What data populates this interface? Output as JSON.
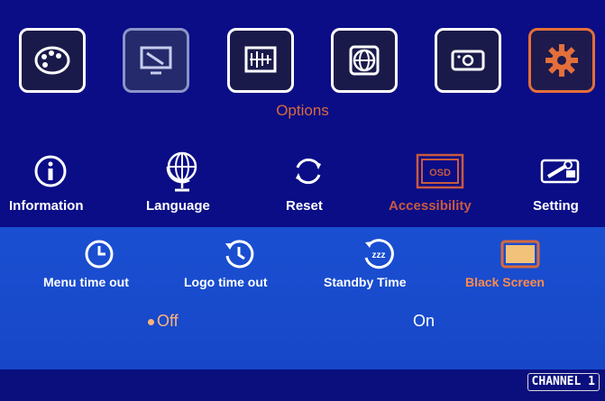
{
  "header": {
    "section_title": "Options"
  },
  "top_menu": [
    {
      "icon": "palette-icon"
    },
    {
      "icon": "display-settings-icon"
    },
    {
      "icon": "equalizer-icon"
    },
    {
      "icon": "globe-icon"
    },
    {
      "icon": "projector-icon"
    },
    {
      "icon": "gear-icon"
    }
  ],
  "submenu": [
    {
      "label": "Information",
      "icon": "info-icon"
    },
    {
      "label": "Language",
      "icon": "globe-stand-icon"
    },
    {
      "label": "Reset",
      "icon": "refresh-icon"
    },
    {
      "label": "Accessibility",
      "icon": "osd-icon",
      "badge": "OSD"
    },
    {
      "label": "Setting",
      "icon": "tools-icon"
    }
  ],
  "options": [
    {
      "label": "Menu time out",
      "icon": "clock-icon"
    },
    {
      "label": "Logo time out",
      "icon": "history-clock-icon"
    },
    {
      "label": "Standby Time",
      "icon": "sleep-clock-icon",
      "badge": "zzz"
    },
    {
      "label": "Black Screen",
      "icon": "screen-rect-icon"
    }
  ],
  "choices": {
    "off": "Off",
    "on": "On",
    "selected": "Off"
  },
  "status": {
    "channel": "CHANNEL 1"
  },
  "colors": {
    "accent": "#e46f3a",
    "background": "#0a0d86",
    "panel": "#1a4fd1"
  }
}
